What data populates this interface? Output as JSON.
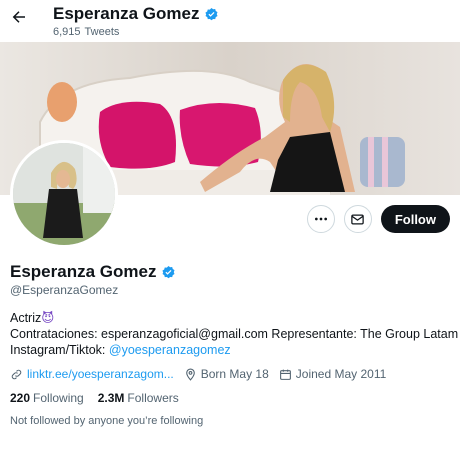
{
  "header": {
    "name": "Esperanza Gomez",
    "tweet_count": "6,915",
    "tweet_count_label": "Tweets"
  },
  "profile": {
    "name": "Esperanza Gomez",
    "handle": "@EsperanzaGomez",
    "bio": {
      "line1": "Actriz",
      "line1_emoji": "😈",
      "line2": "Contrataciones: esperanzagoficial@gmail.com  Representante: The Group Latam",
      "line3_prefix": "Instagram/Tiktok: ",
      "line3_link": "@yoesperanzagomez"
    },
    "website": "linktr.ee/yoesperanzagom...",
    "born": "Born May 18",
    "joined": "Joined May 2011",
    "following_count": "220",
    "following_label": "Following",
    "followers_count": "2.3M",
    "followers_label": "Followers",
    "not_followed": "Not followed by anyone you’re following"
  },
  "actions": {
    "follow_label": "Follow"
  },
  "icons": {
    "back": "back-arrow-icon",
    "verified": "verified-badge-icon",
    "more": "more-icon",
    "message": "mail-icon",
    "link": "link-icon",
    "location": "location-pin-icon",
    "calendar": "calendar-icon"
  },
  "colors": {
    "accent": "#1d9bf0",
    "text": "#0f1419",
    "muted": "#536471",
    "follow_button": "#0f1419"
  }
}
